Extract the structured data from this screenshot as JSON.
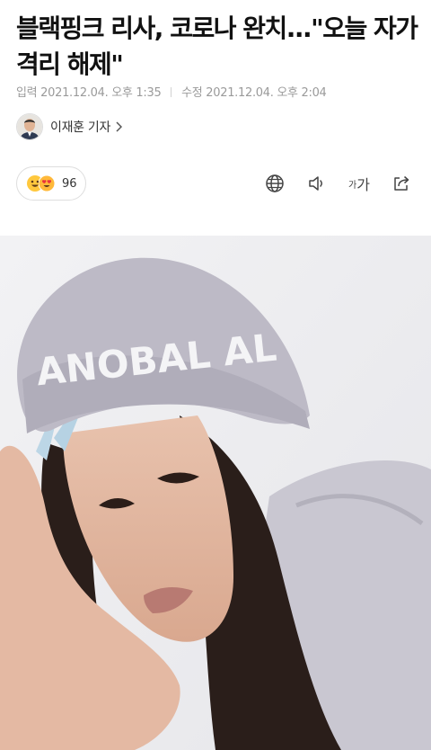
{
  "article": {
    "headline": "블랙핑크 리사, 코로나 완치...\"오늘 자가격리 해제\"",
    "published_label": "입력",
    "published_time": "2021.12.04. 오후 1:35",
    "modified_label": "수정",
    "modified_time": "2021.12.04. 오후 2:04"
  },
  "reporter": {
    "name": "이재훈 기자"
  },
  "reactions": {
    "count": "96"
  },
  "toolbar": {
    "icons": [
      "globe-icon",
      "speaker-icon",
      "font-size-icon",
      "share-icon"
    ],
    "font_small": "가",
    "font_large": "가"
  },
  "photo": {
    "hat_text": "ANOBAL AL"
  },
  "colors": {
    "text_primary": "#111111",
    "text_meta": "#9a9a9a",
    "border": "#dedede",
    "beanie": "#bdbac6",
    "hoodie": "#c9c7d1"
  }
}
